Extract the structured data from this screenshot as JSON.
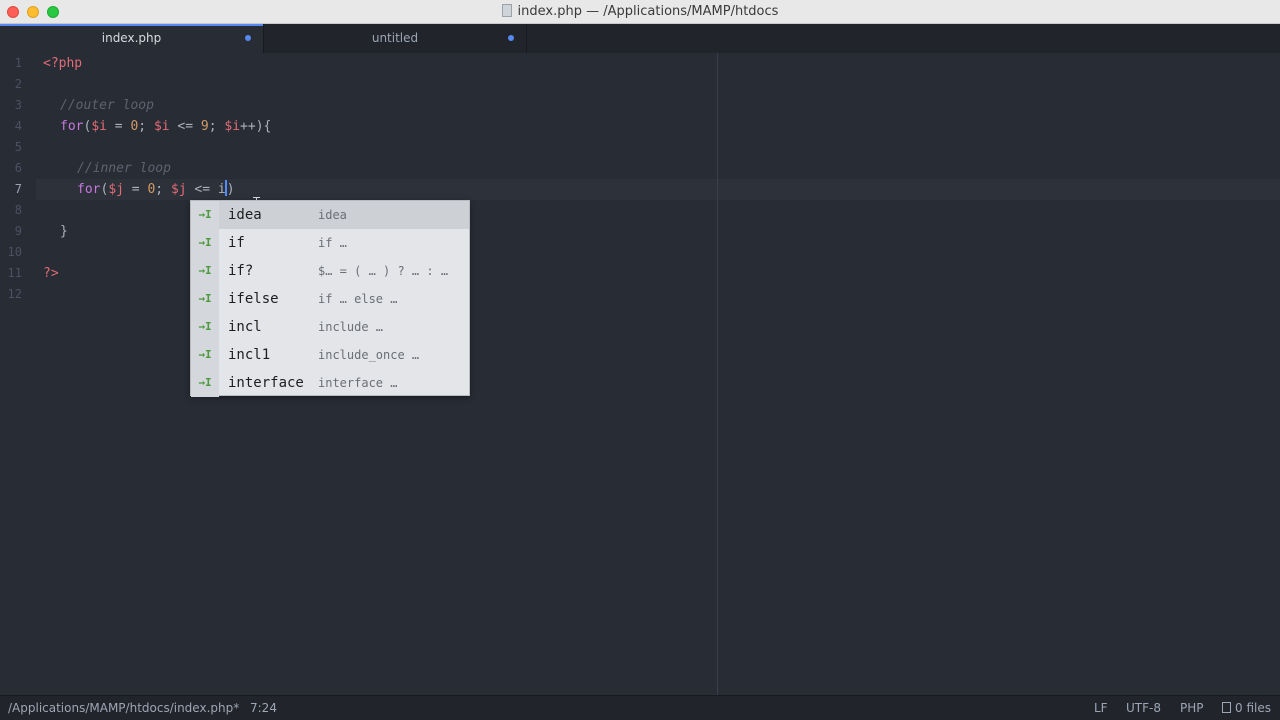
{
  "window": {
    "title": "index.php — /Applications/MAMP/htdocs"
  },
  "tabs": [
    {
      "label": "index.php",
      "modified": true,
      "active": true
    },
    {
      "label": "untitled",
      "modified": true,
      "active": false
    }
  ],
  "editor": {
    "line_numbers": [
      "1",
      "2",
      "3",
      "4",
      "5",
      "6",
      "7",
      "8",
      "9",
      "10",
      "11",
      "12"
    ],
    "current_line": "7",
    "code": {
      "l1": {
        "open_tag": "<?php"
      },
      "l3": {
        "comment": "//outer loop"
      },
      "l4": {
        "kw": "for",
        "p1": "(",
        "v1": "$i",
        "p2": " = ",
        "n1": "0",
        "p3": "; ",
        "v2": "$i",
        "p4": " <= ",
        "n2": "9",
        "p5": "; ",
        "v3": "$i",
        "p6": "++){"
      },
      "l6": {
        "comment": "//inner loop"
      },
      "l7": {
        "kw": "for",
        "p1": "(",
        "v1": "$j",
        "p2": " = ",
        "n1": "0",
        "p3": "; ",
        "v2": "$j",
        "p4": " <= ",
        "typed": "i",
        "close": ")"
      },
      "l9": {
        "text": "}"
      },
      "l11": {
        "close_tag": "?>"
      }
    }
  },
  "autocomplete": {
    "items": [
      {
        "text": "idea",
        "desc": "idea"
      },
      {
        "text": "if",
        "desc": "if …"
      },
      {
        "text": "if?",
        "desc": "$… = ( … ) ? … : …"
      },
      {
        "text": "ifelse",
        "desc": "if … else …"
      },
      {
        "text": "incl",
        "desc": "include …"
      },
      {
        "text": "incl1",
        "desc": "include_once …"
      },
      {
        "text": "interface",
        "desc": "interface …"
      }
    ],
    "icon_glyph": "→I"
  },
  "status_bar": {
    "path": "/Applications/MAMP/htdocs/index.php*",
    "cursor_position": "7:24",
    "line_ending": "LF",
    "encoding": "UTF-8",
    "grammar": "PHP",
    "files": "0 files"
  },
  "colors": {
    "background": "#282c34",
    "accent": "#568af2",
    "keyword": "#c678dd",
    "variable": "#e06c75",
    "number": "#d19a66",
    "comment": "#5c6370"
  }
}
